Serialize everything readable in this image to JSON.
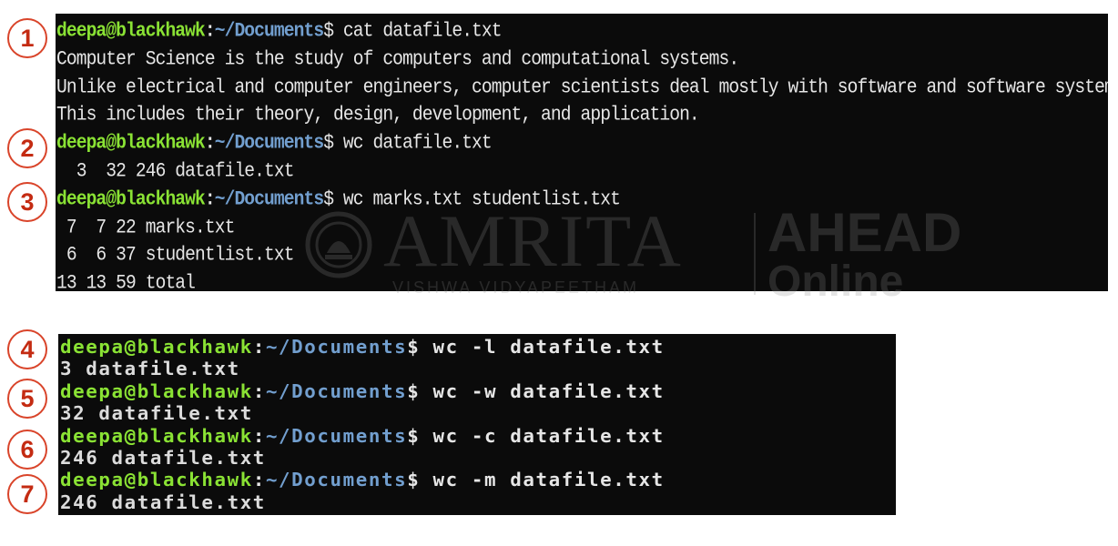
{
  "terminal_top": {
    "lines": [
      {
        "type": "prompt",
        "user": "deepa@blackhawk",
        "path": "~/Documents",
        "command": " cat datafile.txt"
      },
      {
        "type": "output",
        "text": "Computer Science is the study of computers and computational systems."
      },
      {
        "type": "output",
        "text": "Unlike electrical and computer engineers, computer scientists deal mostly with software and software systems."
      },
      {
        "type": "output",
        "text": "This includes their theory, design, development, and application."
      },
      {
        "type": "prompt",
        "user": "deepa@blackhawk",
        "path": "~/Documents",
        "command": " wc datafile.txt"
      },
      {
        "type": "output",
        "text": "  3  32 246 datafile.txt"
      },
      {
        "type": "prompt",
        "user": "deepa@blackhawk",
        "path": "~/Documents",
        "command": " wc marks.txt studentlist.txt"
      },
      {
        "type": "output",
        "text": " 7  7 22 marks.txt"
      },
      {
        "type": "output",
        "text": " 6  6 37 studentlist.txt"
      },
      {
        "type": "output",
        "text": "13 13 59 total"
      }
    ]
  },
  "terminal_bottom": {
    "lines": [
      {
        "type": "prompt",
        "user": "deepa@blackhawk",
        "path": "~/Documents",
        "command": " wc -l datafile.txt"
      },
      {
        "type": "output",
        "text": "3 datafile.txt"
      },
      {
        "type": "prompt",
        "user": "deepa@blackhawk",
        "path": "~/Documents",
        "command": " wc -w datafile.txt"
      },
      {
        "type": "output",
        "text": "32 datafile.txt"
      },
      {
        "type": "prompt",
        "user": "deepa@blackhawk",
        "path": "~/Documents",
        "command": " wc -c datafile.txt"
      },
      {
        "type": "output",
        "text": "246 datafile.txt"
      },
      {
        "type": "prompt",
        "user": "deepa@blackhawk",
        "path": "~/Documents",
        "command": " wc -m datafile.txt"
      },
      {
        "type": "output",
        "text": "246 datafile.txt"
      }
    ]
  },
  "markers": [
    "1",
    "2",
    "3",
    "4",
    "5",
    "6",
    "7"
  ],
  "watermark": {
    "main": "AMRITA",
    "sub": "VISHWA VIDYAPEETHAM",
    "right_top": "AHEAD",
    "right_bottom": "Online"
  },
  "colors": {
    "terminal_bg": "#0b0b0b",
    "user": "#8ae234",
    "path": "#729fcf",
    "text": "#e6e6e6",
    "marker": "#d9442a"
  }
}
